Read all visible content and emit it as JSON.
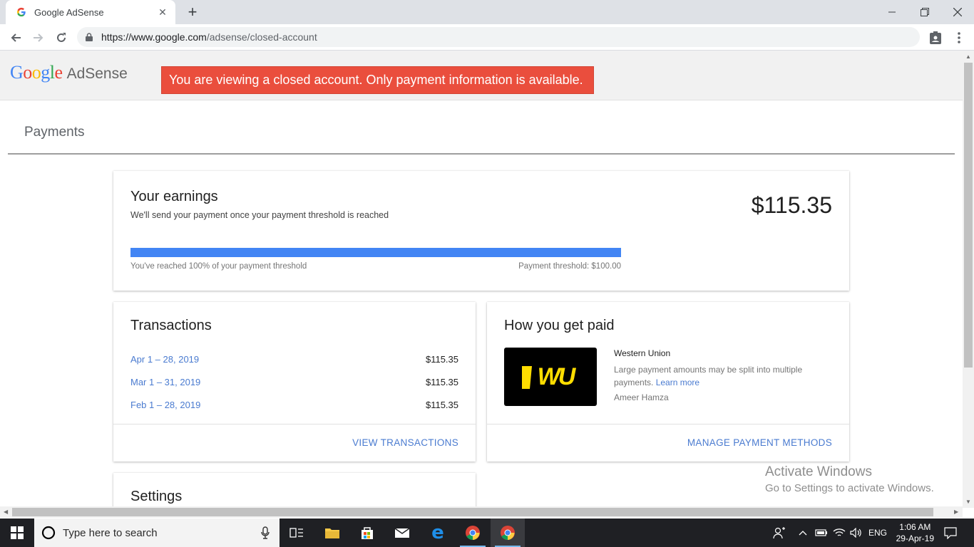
{
  "browser": {
    "tab_title": "Google AdSense",
    "tab_close": "✕",
    "new_tab": "+",
    "url_host": "https://www.google.com",
    "url_path": "/adsense/closed-account"
  },
  "header": {
    "logo_google": "Google",
    "logo_product": "AdSense",
    "banner": "You are viewing a closed account. Only payment information is available."
  },
  "page": {
    "title": "Payments"
  },
  "earnings": {
    "title": "Your earnings",
    "subtitle": "We'll send your payment once your payment threshold is reached",
    "amount": "$115.35",
    "progress_percent": 100,
    "progress_left": "You've reached 100% of your payment threshold",
    "progress_right": "Payment threshold: $100.00"
  },
  "transactions": {
    "title": "Transactions",
    "rows": [
      {
        "date": "Apr 1 – 28, 2019",
        "amount": "$115.35"
      },
      {
        "date": "Mar 1 – 31, 2019",
        "amount": "$115.35"
      },
      {
        "date": "Feb 1 – 28, 2019",
        "amount": "$115.35"
      }
    ],
    "link": "VIEW TRANSACTIONS"
  },
  "payment_method": {
    "title": "How you get paid",
    "logo_text": "WU",
    "name": "Western Union",
    "description": "Large payment amounts may be split into multiple payments.",
    "learn_more": "Learn more",
    "owner": "Ameer Hamza",
    "link": "MANAGE PAYMENT METHODS"
  },
  "settings": {
    "title": "Settings"
  },
  "watermark": {
    "line1": "Activate Windows",
    "line2": "Go to Settings to activate Windows."
  },
  "taskbar": {
    "search_placeholder": "Type here to search",
    "language": "ENG",
    "time": "1:06 AM",
    "date": "29-Apr-19"
  },
  "colors": {
    "banner_bg": "#ea4e3d",
    "link": "#4a7bd0",
    "progress": "#4285f4",
    "wu_yellow": "#ffdd00"
  }
}
